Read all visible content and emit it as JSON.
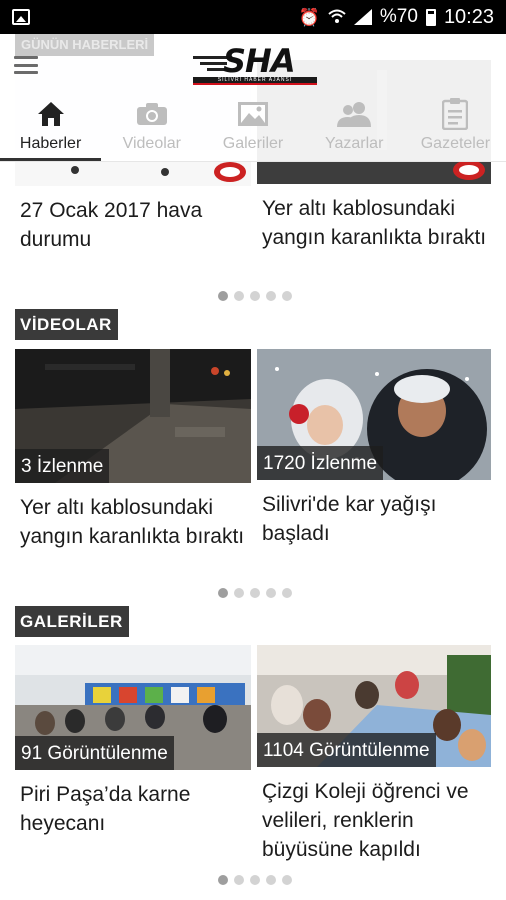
{
  "status_bar": {
    "battery_text": "%70",
    "time": "10:23",
    "icons": [
      "image-icon",
      "alarm-icon",
      "wifi-icon",
      "signal-icon",
      "battery-icon"
    ]
  },
  "header": {
    "logo_text": "SHA",
    "logo_subtext": "SİLİVRİ HABER AJANSI",
    "ghost_label": "GÜNÜN HABERLERİ"
  },
  "tabs": [
    {
      "label": "Haberler",
      "icon": "home-icon",
      "active": true
    },
    {
      "label": "Videolar",
      "icon": "camera-icon",
      "active": false
    },
    {
      "label": "Galeriler",
      "icon": "gallery-icon",
      "active": false
    },
    {
      "label": "Yazarlar",
      "icon": "users-icon",
      "active": false
    },
    {
      "label": "Gazeteler",
      "icon": "clipboard-icon",
      "active": false
    }
  ],
  "news": {
    "items": [
      {
        "title": "27 Ocak 2017 hava durumu"
      },
      {
        "title": "Yer altı kablosundaki yangın karanlıkta bıraktı"
      }
    ],
    "pager": {
      "count": 5,
      "active": 0
    }
  },
  "videos": {
    "label": "VİDEOLAR",
    "items": [
      {
        "views": "3 İzlenme",
        "title": "Yer altı kablosundaki yangın karanlıkta bıraktı"
      },
      {
        "views": "1720 İzlenme",
        "title": "Silivri'de kar yağışı başladı"
      }
    ],
    "pager": {
      "count": 5,
      "active": 0
    }
  },
  "galleries": {
    "label": "GALERİLER",
    "items": [
      {
        "views": "91 Görüntülenme",
        "title": "Piri Paşa’da karne heyecanı"
      },
      {
        "views": "1104 Görüntülenme",
        "title": "Çizgi Koleji öğrenci ve velileri, renklerin büyüsüne kapıldı"
      }
    ],
    "pager": {
      "count": 5,
      "active": 0
    }
  },
  "colors": {
    "label_bg": "#3a3a3a",
    "active_tab": "#222222",
    "inactive_tab": "#bdbdbd",
    "accent_red": "#d0101b"
  }
}
